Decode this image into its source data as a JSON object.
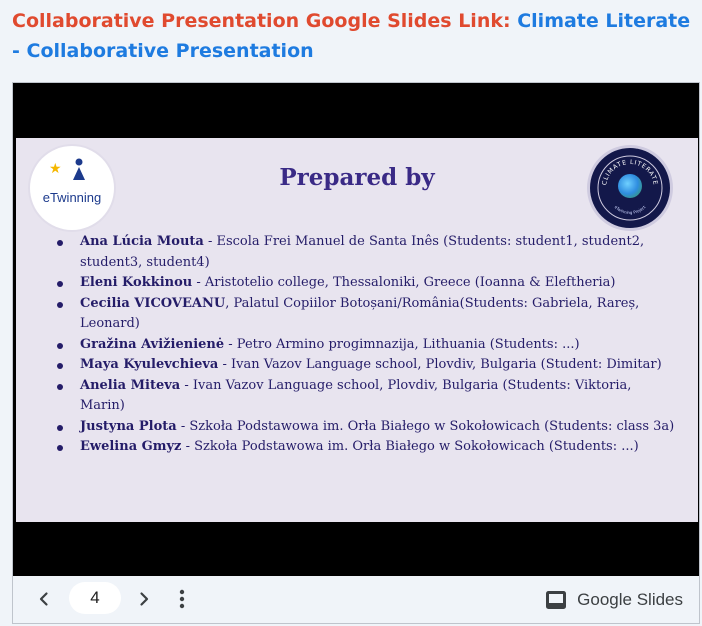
{
  "heading": {
    "label": "Collaborative Presentation Google Slides Link:",
    "link_text": "Climate Literate - Collaborative Presentation"
  },
  "slide": {
    "title": "Prepared by",
    "logo_left_text": "eTwinning",
    "logo_right_text": "CLIMATE LITERATE",
    "logo_right_subtext": "eTwinning Project",
    "people": [
      {
        "name": "Ana Lúcia Mouta",
        "detail": " - Escola Frei Manuel de Santa Inês (Students: student1, student2, student3, student4)"
      },
      {
        "name": "Eleni Kokkinou",
        "detail": " - Aristotelio college, Thessaloniki, Greece (Ioanna & Eleftheria)"
      },
      {
        "name": "Cecilia VICOVEANU",
        "detail": ", Palatul Copiilor Botoșani/România(Students: Gabriela, Rareș, Leonard)"
      },
      {
        "name": "Gražina Avižienienė",
        "detail": " - Petro Armino progimnazija, Lithuania (Students: ...)"
      },
      {
        "name": "Maya Kyulevchieva",
        "detail": " - Ivan Vazov Language school, Plovdiv, Bulgaria (Student: Dimitar)"
      },
      {
        "name": "Anelia Miteva",
        "detail": " - Ivan Vazov Language school, Plovdiv, Bulgaria (Students: Viktoria, Marin)"
      },
      {
        "name": "Justyna Plota",
        "detail": " - Szkoła Podstawowa im. Orła Białego w Sokołowicach (Students: class 3a)"
      },
      {
        "name": "Ewelina Gmyz",
        "detail": " - Szkoła Podstawowa im. Orła Białego w Sokołowicach (Students: ...)"
      }
    ]
  },
  "controls": {
    "page_number": "4",
    "prev_icon": "chevron-left-icon",
    "next_icon": "chevron-right-icon",
    "more_icon": "more-vert-icon",
    "brand_label": "Google Slides"
  },
  "colors": {
    "heading_label": "#e04a2f",
    "heading_link": "#1e7be0",
    "slide_bg": "#e8e4ef",
    "slide_title": "#3a2a86",
    "slide_text": "#241c68"
  }
}
